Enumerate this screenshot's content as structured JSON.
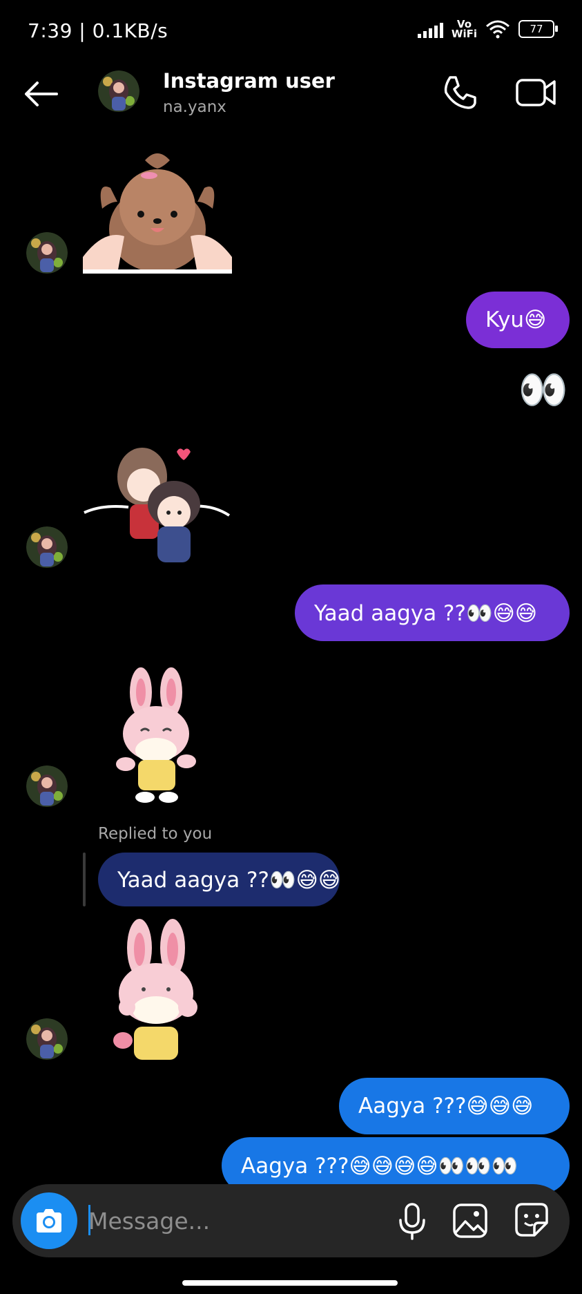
{
  "status_bar": {
    "time": "7:39 | 0.1KB/s",
    "vowifi_top": "Vo",
    "vowifi_bottom": "WiFi",
    "battery": "77"
  },
  "header": {
    "title": "Instagram user",
    "username": "na.yanx"
  },
  "messages": [
    {
      "type": "sticker",
      "from": "them",
      "icon": "puppy-sticker"
    },
    {
      "type": "text",
      "from": "me",
      "text": "Kyu😅"
    },
    {
      "type": "emoji",
      "from": "me",
      "text": "👀"
    },
    {
      "type": "sticker",
      "from": "them",
      "icon": "couple-sticker"
    },
    {
      "type": "text",
      "from": "me",
      "text": "Yaad aagya ??👀😅😅"
    },
    {
      "type": "sticker",
      "from": "them",
      "icon": "bunny-waving-sticker"
    },
    {
      "type": "reply",
      "from": "them",
      "label": "Replied to you",
      "text": "Yaad aagya ??👀😅😅"
    },
    {
      "type": "sticker",
      "from": "them",
      "icon": "bunny-cheeks-sticker"
    },
    {
      "type": "text",
      "from": "me",
      "text": "Aagya ???😅😅😅"
    },
    {
      "type": "text",
      "from": "me",
      "text": "Aagya ???😅😅😅😅👀👀👀"
    }
  ],
  "composer": {
    "placeholder": "Message..."
  },
  "colors": {
    "bubble_purple": "#7b2fd6",
    "bubble_violet": "#6a38d6",
    "bubble_blue": "#1877e6",
    "reply_bubble": "#1d2c6e",
    "camera_button": "#1b8ef2"
  }
}
